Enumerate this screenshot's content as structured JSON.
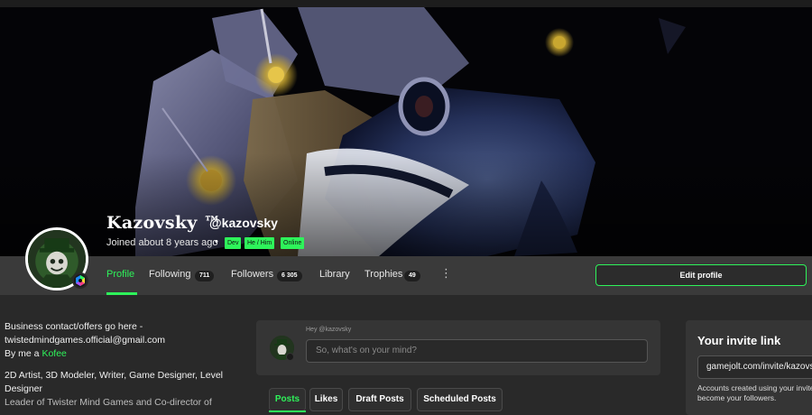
{
  "profile": {
    "display_name": "Kazovsky ™",
    "handle": "@kazovsky",
    "joined": "Joined about 8 years ago",
    "separator": "•",
    "tags": {
      "dev": "Dev",
      "pronouns": "He / Him",
      "online": "Online"
    }
  },
  "nav": {
    "profile": "Profile",
    "following": "Following",
    "following_count": "711",
    "followers": "Followers",
    "followers_count": "6 305",
    "library": "Library",
    "trophies": "Trophies",
    "trophies_count": "49",
    "more": "⋮",
    "edit_profile": "Edit profile"
  },
  "bio": {
    "line1": "Business contact/offers go here -",
    "line2": "twistedmindgames.official@gmail.com",
    "line3_prefix": "By me a ",
    "line3_link": "Kofee",
    "line4": "2D Artist, 3D Modeler, Writer, Game Designer, Level",
    "line5": "Designer",
    "line6": "Leader of Twister Mind Games and Co-director of"
  },
  "post_box": {
    "greeting": "Hey @kazovsky",
    "placeholder": "So, what's on your mind?"
  },
  "post_tabs": {
    "posts": "Posts",
    "likes": "Likes",
    "drafts": "Draft Posts",
    "scheduled": "Scheduled Posts"
  },
  "invite": {
    "title": "Your invite link",
    "link": "gamejolt.com/invite/kazovsky",
    "desc_line1": "Accounts created using your invite link",
    "desc_line2": "become your followers."
  },
  "colors": {
    "accent": "#2ef35a",
    "background": "#292929",
    "nav_bar": "#3a3a3a",
    "panel": "#353535"
  }
}
